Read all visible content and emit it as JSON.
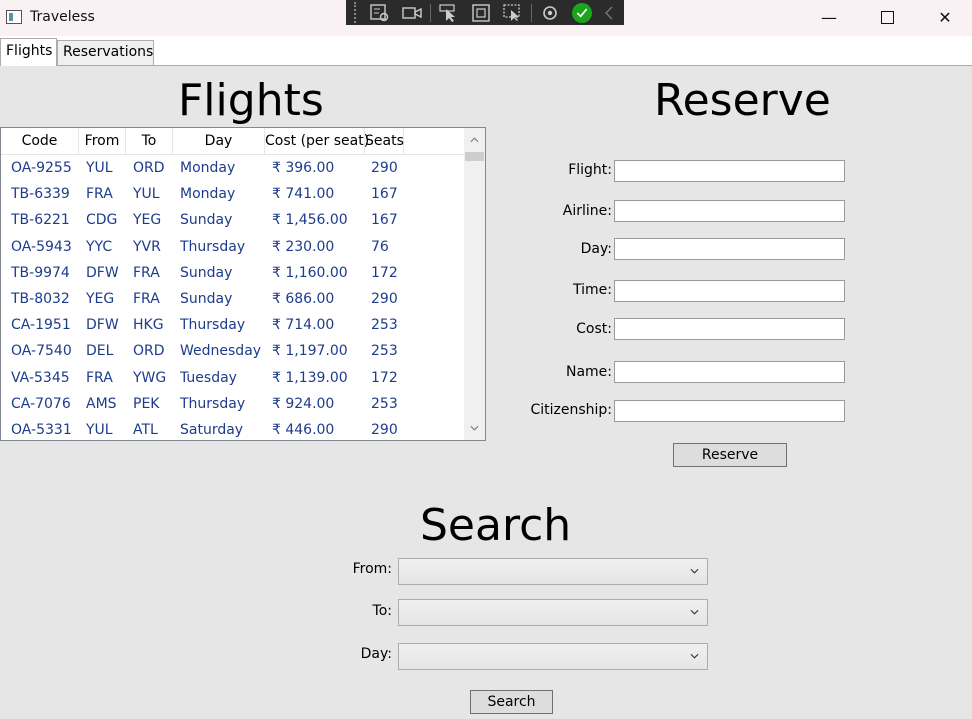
{
  "window": {
    "title": "Traveless",
    "minimize_glyph": "—",
    "close_glyph": "✕"
  },
  "debug_toolbar": {
    "icons": [
      "select-element-icon",
      "video-icon",
      "pointer-icon",
      "layout-box-icon",
      "preview-selection-icon",
      "hot-reload-icon",
      "check-icon",
      "collapse-chevron-icon"
    ]
  },
  "tabs": [
    {
      "label": "Flights",
      "selected": true
    },
    {
      "label": "Reservations",
      "selected": false
    }
  ],
  "flights_heading": "Flights",
  "reserve_heading": "Reserve",
  "search_heading": "Search",
  "grid": {
    "columns": [
      "Code",
      "From",
      "To",
      "Day",
      "Cost (per seat)",
      "Seats"
    ],
    "rows": [
      [
        "OA-9255",
        "YUL",
        "ORD",
        "Monday",
        "₹ 396.00",
        "290"
      ],
      [
        "TB-6339",
        "FRA",
        "YUL",
        "Monday",
        "₹ 741.00",
        "167"
      ],
      [
        "TB-6221",
        "CDG",
        "YEG",
        "Sunday",
        "₹ 1,456.00",
        "167"
      ],
      [
        "OA-5943",
        "YYC",
        "YVR",
        "Thursday",
        "₹ 230.00",
        "76"
      ],
      [
        "TB-9974",
        "DFW",
        "FRA",
        "Sunday",
        "₹ 1,160.00",
        "172"
      ],
      [
        "TB-8032",
        "YEG",
        "FRA",
        "Sunday",
        "₹ 686.00",
        "290"
      ],
      [
        "CA-1951",
        "DFW",
        "HKG",
        "Thursday",
        "₹ 714.00",
        "253"
      ],
      [
        "OA-7540",
        "DEL",
        "ORD",
        "Wednesday",
        "₹ 1,197.00",
        "253"
      ],
      [
        "VA-5345",
        "FRA",
        "YWG",
        "Tuesday",
        "₹ 1,139.00",
        "172"
      ],
      [
        "CA-7076",
        "AMS",
        "PEK",
        "Thursday",
        "₹ 924.00",
        "253"
      ],
      [
        "OA-5331",
        "YUL",
        "ATL",
        "Saturday",
        "₹ 446.00",
        "290"
      ]
    ]
  },
  "reserve_form": {
    "flight_label": "Flight:",
    "airline_label": "Airline:",
    "day_label": "Day:",
    "time_label": "Time:",
    "cost_label": "Cost:",
    "name_label": "Name:",
    "citizenship_label": "Citizenship:",
    "flight_value": "",
    "airline_value": "",
    "day_value": "",
    "time_value": "",
    "cost_value": "",
    "name_value": "",
    "citizenship_value": "",
    "reserve_button": "Reserve"
  },
  "search_form": {
    "from_label": "From:",
    "to_label": "To:",
    "day_label": "Day:",
    "from_value": "",
    "to_value": "",
    "day_value": "",
    "search_button": "Search"
  }
}
